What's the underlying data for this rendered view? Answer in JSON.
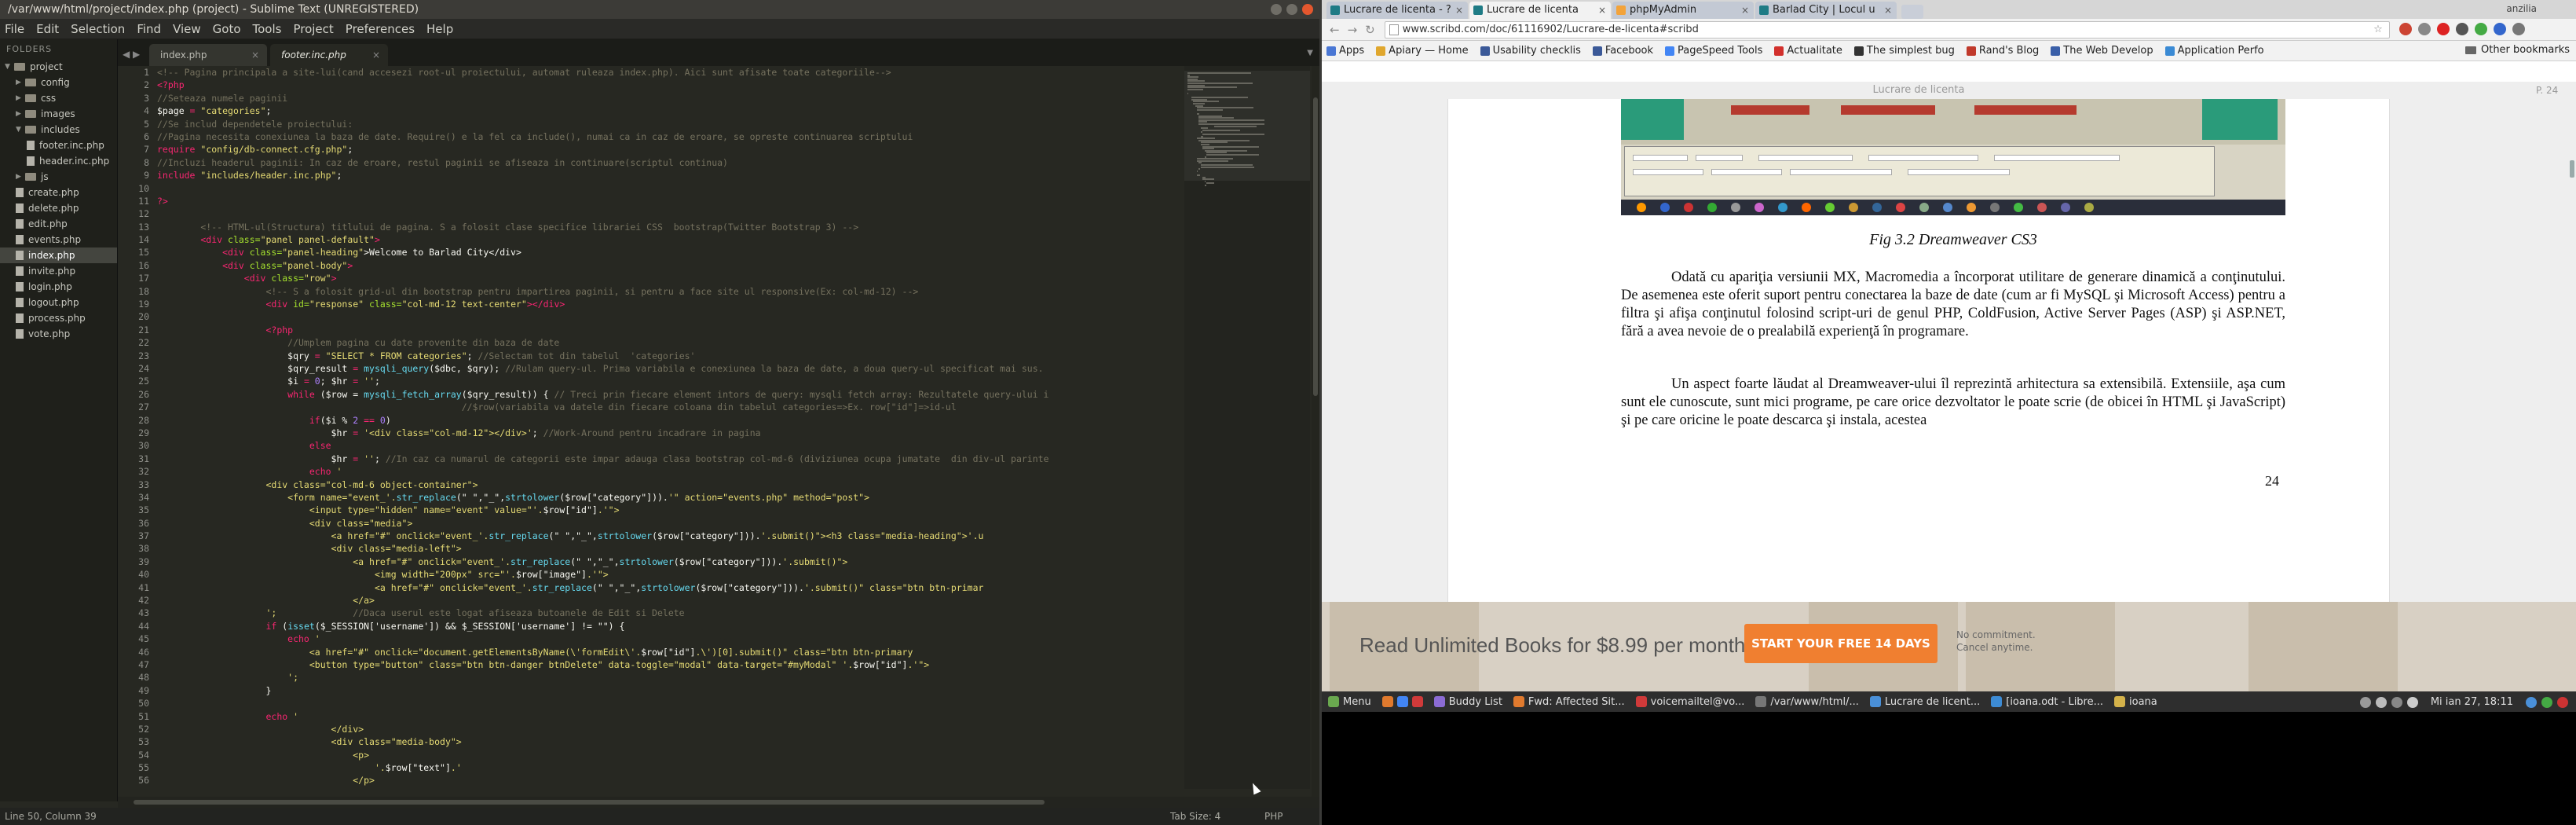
{
  "sublime": {
    "title": "/var/www/html/project/index.php (project) - Sublime Text (UNREGISTERED)",
    "menu": [
      "File",
      "Edit",
      "Selection",
      "Find",
      "View",
      "Goto",
      "Tools",
      "Project",
      "Preferences",
      "Help"
    ],
    "sidebar_header": "FOLDERS",
    "tree": [
      {
        "label": "project",
        "type": "folder",
        "open": true,
        "indent": 0
      },
      {
        "label": "config",
        "type": "folder",
        "open": false,
        "indent": 1
      },
      {
        "label": "css",
        "type": "folder",
        "open": false,
        "indent": 1
      },
      {
        "label": "images",
        "type": "folder",
        "open": false,
        "indent": 1
      },
      {
        "label": "includes",
        "type": "folder",
        "open": true,
        "indent": 1
      },
      {
        "label": "footer.inc.php",
        "type": "file",
        "indent": 2
      },
      {
        "label": "header.inc.php",
        "type": "file",
        "indent": 2
      },
      {
        "label": "js",
        "type": "folder",
        "open": false,
        "indent": 1
      },
      {
        "label": "create.php",
        "type": "file",
        "indent": 1
      },
      {
        "label": "delete.php",
        "type": "file",
        "indent": 1
      },
      {
        "label": "edit.php",
        "type": "file",
        "indent": 1
      },
      {
        "label": "events.php",
        "type": "file",
        "indent": 1
      },
      {
        "label": "index.php",
        "type": "file",
        "indent": 1,
        "active": true
      },
      {
        "label": "invite.php",
        "type": "file",
        "indent": 1
      },
      {
        "label": "login.php",
        "type": "file",
        "indent": 1
      },
      {
        "label": "logout.php",
        "type": "file",
        "indent": 1
      },
      {
        "label": "process.php",
        "type": "file",
        "indent": 1
      },
      {
        "label": "vote.php",
        "type": "file",
        "indent": 1
      }
    ],
    "tabs": [
      {
        "label": "index.php",
        "active": false
      },
      {
        "label": "footer.inc.php",
        "active": true
      }
    ],
    "code_lines": [
      [
        [
          "<!-- Pagina principala a site-lui(cand accesezi root-ul proiectului, automat ruleaza index.php). Aici sunt afisate toate categoriile-->",
          "c"
        ]
      ],
      [
        [
          "<?php",
          "k"
        ]
      ],
      [
        [
          "//Seteaza numele paginii",
          "c"
        ]
      ],
      [
        [
          "$page",
          "v"
        ],
        [
          " = ",
          "o"
        ],
        [
          "\"categories\"",
          "s"
        ],
        [
          ";",
          "t"
        ]
      ],
      [
        [
          "//Se includ dependetele proiectului:",
          "c"
        ]
      ],
      [
        [
          "//Pagina necesita conexiunea la baza de date. Require() e la fel ca include(), numai ca in caz de eroare, se opreste continuarea scriptului",
          "c"
        ]
      ],
      [
        [
          "require ",
          "k"
        ],
        [
          "\"config/db-connect.cfg.php\"",
          "s"
        ],
        [
          ";",
          "t"
        ]
      ],
      [
        [
          "//Incluzi headerul paginii: In caz de eroare, restul paginii se afiseaza in continuare(scriptul continua)",
          "c"
        ]
      ],
      [
        [
          "include ",
          "k"
        ],
        [
          "\"includes/header.inc.php\"",
          "s"
        ],
        [
          ";",
          "t"
        ]
      ],
      [
        [
          "",
          "t"
        ]
      ],
      [
        [
          "?>",
          "k"
        ]
      ],
      [
        [
          "",
          "t"
        ]
      ],
      [
        [
          "        <!-- HTML-ul(Structura) titlului de pagina. S a folosit clase specifice librariei CSS  bootstrap(Twitter Bootstrap 3) -->",
          "c"
        ]
      ],
      [
        [
          "        <div ",
          "k"
        ],
        [
          "class=",
          "a"
        ],
        [
          "\"panel panel-default\"",
          "s"
        ],
        [
          ">",
          "k"
        ]
      ],
      [
        [
          "            <div ",
          "k"
        ],
        [
          "class=",
          "a"
        ],
        [
          "\"panel-heading\"",
          "s"
        ],
        [
          ">Welcome to Barlad City</div>",
          "t"
        ]
      ],
      [
        [
          "            <div ",
          "k"
        ],
        [
          "class=",
          "a"
        ],
        [
          "\"panel-body\"",
          "s"
        ],
        [
          ">",
          "k"
        ]
      ],
      [
        [
          "                <div ",
          "k"
        ],
        [
          "class=",
          "a"
        ],
        [
          "\"row\"",
          "s"
        ],
        [
          ">",
          "k"
        ]
      ],
      [
        [
          "                    <!-- S a folosit grid-ul din bootstrap pentru impartirea paginii, si pentru a face site ul responsive(Ex: col-md-12) -->",
          "c"
        ]
      ],
      [
        [
          "                    <div ",
          "k"
        ],
        [
          "id=",
          "a"
        ],
        [
          "\"response\" ",
          "s"
        ],
        [
          "class=",
          "a"
        ],
        [
          "\"col-md-12 text-center\"",
          "s"
        ],
        [
          "></div>",
          "k"
        ]
      ],
      [
        [
          "",
          "t"
        ]
      ],
      [
        [
          "                    <?php",
          "k"
        ]
      ],
      [
        [
          "                        //Umplem pagina cu date provenite din baza de date",
          "c"
        ]
      ],
      [
        [
          "                        $qry",
          "v"
        ],
        [
          " = ",
          "o"
        ],
        [
          "\"SELECT * FROM categories\"",
          "s"
        ],
        [
          "; ",
          "t"
        ],
        [
          "//Selectam tot din tabelul  'categories'",
          "c"
        ]
      ],
      [
        [
          "                        $qry_result",
          "v"
        ],
        [
          " = ",
          "o"
        ],
        [
          "mysqli_query",
          "f"
        ],
        [
          "($dbc, $qry); ",
          "t"
        ],
        [
          "//Rulam query-ul. Prima variabila e conexiunea la baza de date, a doua query-ul specificat mai sus.",
          "c"
        ]
      ],
      [
        [
          "                        $i",
          "v"
        ],
        [
          " = ",
          "o"
        ],
        [
          "0",
          "n"
        ],
        [
          "; ",
          "t"
        ],
        [
          "$hr",
          "v"
        ],
        [
          " = ",
          "o"
        ],
        [
          "''",
          "s"
        ],
        [
          ";",
          "t"
        ]
      ],
      [
        [
          "                        while ",
          "k"
        ],
        [
          "($row = ",
          "t"
        ],
        [
          "mysqli_fetch_array",
          "f"
        ],
        [
          "($qry_result)) { ",
          "t"
        ],
        [
          "// Treci prin fiecare element intors de query: mysqli fetch array: Rezultatele query-ului i",
          "c"
        ]
      ],
      [
        [
          "                                                        //$row(variabila va datele din fiecare coloana din tabelul categories=>Ex. row[\"id\"]=>id-ul",
          "c"
        ]
      ],
      [
        [
          "                            if",
          "k"
        ],
        [
          "($i % ",
          "t"
        ],
        [
          "2",
          "n"
        ],
        [
          " == ",
          "o"
        ],
        [
          "0",
          "n"
        ],
        [
          ")",
          "t"
        ]
      ],
      [
        [
          "                                $hr",
          "v"
        ],
        [
          " = ",
          "o"
        ],
        [
          "'<div class=\"col-md-12\"></div>'",
          "s"
        ],
        [
          "; ",
          "t"
        ],
        [
          "//Work-Around pentru incadrare in pagina",
          "c"
        ]
      ],
      [
        [
          "                            else",
          "k"
        ]
      ],
      [
        [
          "                                $hr",
          "v"
        ],
        [
          " = ",
          "o"
        ],
        [
          "''",
          "s"
        ],
        [
          "; ",
          "t"
        ],
        [
          "//In caz ca numarul de categorii este impar adauga clasa bootstrap col-md-6 (diviziunea ocupa jumatate  din div-ul parinte",
          "c"
        ]
      ],
      [
        [
          "                            echo ",
          "k"
        ],
        [
          "'",
          "s"
        ]
      ],
      [
        [
          "                    <div class=\"col-md-6 object-container\">",
          "s"
        ]
      ],
      [
        [
          "                        <form name=\"event_'.",
          "s"
        ],
        [
          "str_replace",
          "f"
        ],
        [
          "(\" \",\"_\",",
          "t"
        ],
        [
          "strtolower",
          "f"
        ],
        [
          "($row[\"category\"])).",
          "t"
        ],
        [
          "'\" action=\"events.php\" method=\"post\">",
          "s"
        ]
      ],
      [
        [
          "                            <input type=\"hidden\" name=\"event\" value=\"'.",
          "s"
        ],
        [
          "$row[\"id\"]",
          "v"
        ],
        [
          ".'\">",
          "s"
        ]
      ],
      [
        [
          "                            <div class=\"media\">",
          "s"
        ]
      ],
      [
        [
          "                                <a href=\"#\" onclick=\"event_'.",
          "s"
        ],
        [
          "str_replace",
          "f"
        ],
        [
          "(\" \",\"_\",",
          "t"
        ],
        [
          "strtolower",
          "f"
        ],
        [
          "($row[\"category\"])).",
          "t"
        ],
        [
          "'.submit()\"><h3 class=\"media-heading\">'.u",
          "s"
        ]
      ],
      [
        [
          "                                <div class=\"media-left\">",
          "s"
        ]
      ],
      [
        [
          "                                    <a href=\"#\" onclick=\"event_'.",
          "s"
        ],
        [
          "str_replace",
          "f"
        ],
        [
          "(\" \",\"_\",",
          "t"
        ],
        [
          "strtolower",
          "f"
        ],
        [
          "($row[\"category\"])).",
          "t"
        ],
        [
          "'.submit()\">",
          "s"
        ]
      ],
      [
        [
          "                                        <img width=\"200px\" src=\"'.",
          "s"
        ],
        [
          "$row[\"image\"]",
          "v"
        ],
        [
          ".'\">",
          "s"
        ]
      ],
      [
        [
          "                                        <a href=\"#\" onclick=\"event_'.",
          "s"
        ],
        [
          "str_replace",
          "f"
        ],
        [
          "(\" \",\"_\",",
          "t"
        ],
        [
          "strtolower",
          "f"
        ],
        [
          "($row[\"category\"])).",
          "t"
        ],
        [
          "'.submit()\" class=\"btn btn-primar",
          "s"
        ]
      ],
      [
        [
          "                                    </a>",
          "s"
        ]
      ],
      [
        [
          "                    ';",
          "s"
        ],
        [
          "              //Daca userul este logat afiseaza butoanele de Edit si Delete",
          "c"
        ]
      ],
      [
        [
          "                    if ",
          "k"
        ],
        [
          "(",
          "t"
        ],
        [
          "isset",
          "f"
        ],
        [
          "($_SESSION['username']) && $_SESSION['username'] != \"\") {",
          "t"
        ]
      ],
      [
        [
          "                        echo ",
          "k"
        ],
        [
          "'",
          "s"
        ]
      ],
      [
        [
          "                            <a href=\"#\" onclick=\"document.getElementsByName(\\'formEdit\\'.",
          "s"
        ],
        [
          "$row[\"id\"]",
          "v"
        ],
        [
          ".\\')[0].submit()\" class=\"btn btn-primary",
          "s"
        ]
      ],
      [
        [
          "                            <button type=\"button\" class=\"btn btn-danger btnDelete\" data-toggle=\"modal\" data-target=\"#myModal\" '.",
          "s"
        ],
        [
          "$row[\"id\"]",
          "v"
        ],
        [
          ".'\">",
          "s"
        ]
      ],
      [
        [
          "                        ';",
          "s"
        ]
      ],
      [
        [
          "                    }",
          "t"
        ]
      ],
      [
        [
          "",
          "t"
        ]
      ],
      [
        [
          "                    echo ",
          "k"
        ],
        [
          "'",
          "s"
        ]
      ],
      [
        [
          "                                </div>",
          "s"
        ]
      ],
      [
        [
          "                                <div class=\"media-body\">",
          "s"
        ]
      ],
      [
        [
          "                                    <p>",
          "s"
        ]
      ],
      [
        [
          "                                        '.",
          "s"
        ],
        [
          "$row[\"text\"]",
          "v"
        ],
        [
          ".'",
          "s"
        ]
      ],
      [
        [
          "                                    </p>",
          "s"
        ]
      ]
    ],
    "status_left": "Line 50, Column 39",
    "status_tab": "Tab Size: 4",
    "status_syntax": "PHP"
  },
  "browser": {
    "tabs": [
      {
        "label": "Lucrare de licenta - ?",
        "active": false,
        "fav": "scribd"
      },
      {
        "label": "Lucrare de licenta",
        "active": true,
        "fav": "scribd"
      },
      {
        "label": "phpMyAdmin",
        "active": false,
        "fav": "pma"
      },
      {
        "label": "Barlad City | Locul u",
        "active": false,
        "fav": "scribd"
      }
    ],
    "url": "www.scribd.com/doc/61116902/Lucrare-de-licenta#scribd",
    "bookmarks": [
      "Apps",
      "Apiary — Home",
      "Usability checklis",
      "Facebook",
      "PageSpeed Tools",
      "Actualitate",
      "The simplest bug",
      "Rand's Blog",
      "The Web Develop",
      "Application Perfo"
    ],
    "bookmark_colors": [
      "#4a77d4",
      "#e0a72e",
      "#3b5998",
      "#3b5998",
      "#4285f4",
      "#d2302c",
      "#333333",
      "#c0392b",
      "#3a5fa8",
      "#3a8ad4"
    ],
    "other_bookmarks": "Other bookmarks",
    "user_label": "anzilia",
    "doc_header": "Lucrare de licenta",
    "doc_page_indicator": "P. 24",
    "figure_caption": "Fig 3.2 Dreamweaver CS3",
    "paragraph1": "Odată cu apariţia versiunii MX, Macromedia a încorporat utilitare de generare dinamică a conţinutului. De asemenea este oferit suport pentru conectarea la baze de date (cum ar fi MySQL şi Microsoft Access) pentru a filtra şi afişa conţinutul folosind script-uri de genul PHP, ColdFusion, Active Server Pages (ASP) şi ASP.NET, fără a avea nevoie de o prealabilă experienţă în programare.",
    "paragraph2": "Un aspect foarte lăudat al Dreamweaver-ului îl reprezintă arhitectura sa extensibilă. Extensiile, aşa cum sunt ele cunoscute, sunt mici programe, pe care orice dezvoltator le poate scrie (de obicei în HTML şi JavaScript) şi pe care oricine le poate descarca şi instala, acestea",
    "page_number": "24",
    "banner_text": "Read Unlimited Books for $8.99 per month",
    "banner_button": "START YOUR FREE 14 DAYS",
    "banner_note1": "No commitment.",
    "banner_note2": "Cancel anytime."
  },
  "taskbar": {
    "menu": "Menu",
    "items": [
      {
        "label": "Buddy List",
        "color": "#8b6bd4"
      },
      {
        "label": "Fwd: Affected Sit...",
        "color": "#e07a2e"
      },
      {
        "label": "voicemailtel@vo...",
        "color": "#d03a3a"
      },
      {
        "label": "/var/www/html/...",
        "color": "#777777"
      },
      {
        "label": "Lucrare de licent...",
        "color": "#4a90d9"
      },
      {
        "label": "[ioana.odt - Libre...",
        "color": "#3d8bd4"
      },
      {
        "label": "ioana",
        "color": "#d4b24a"
      }
    ],
    "clock": "Mi ian 27, 18:11"
  }
}
